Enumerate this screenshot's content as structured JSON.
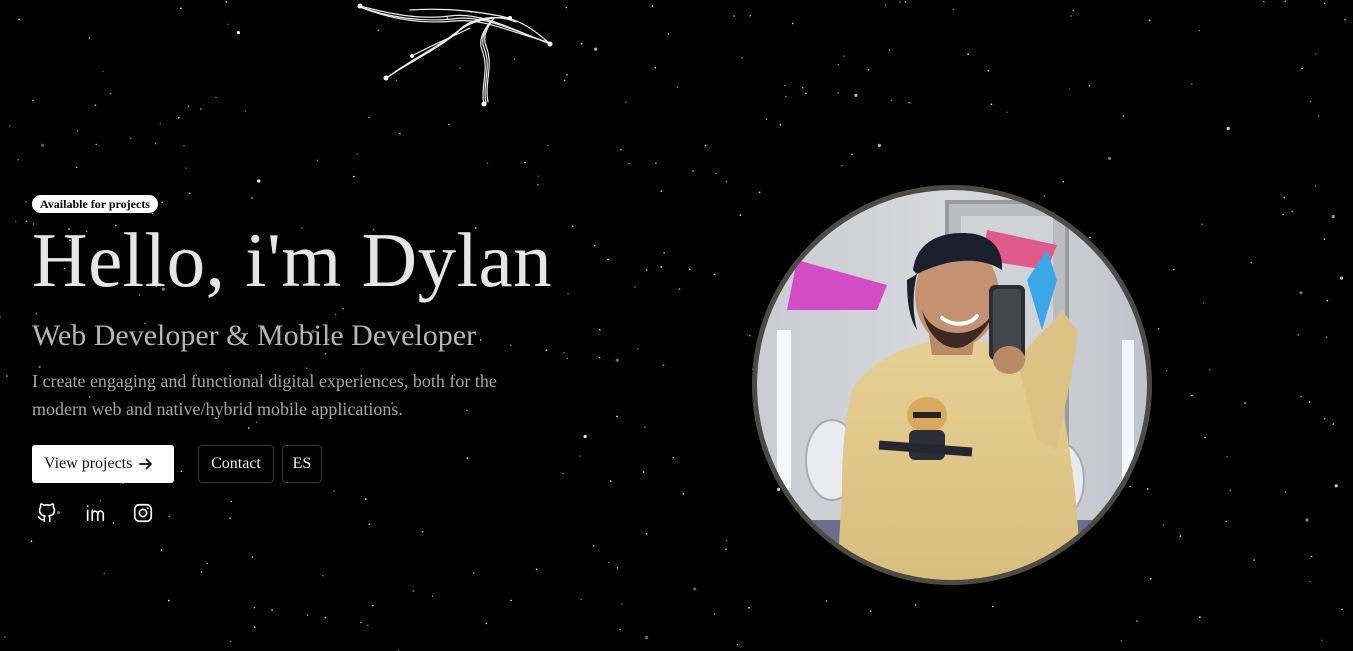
{
  "hero": {
    "badge": "Available for projects",
    "title": "Hello, i'm Dylan",
    "subtitle": "Web Developer & Mobile Developer",
    "description": "I create engaging and functional digital experiences, both for the modern web and native/hybrid mobile applications."
  },
  "actions": {
    "projects_label": "View projects",
    "projects_icon": "arrow-right-icon",
    "contact_label": "Contact",
    "language_label": "ES"
  },
  "socials": [
    {
      "icon": "github-icon"
    },
    {
      "icon": "linkedin-icon"
    },
    {
      "icon": "instagram-icon"
    }
  ],
  "colors": {
    "background": "#000000",
    "text": "#e6e6e6",
    "muted": "#a5a5a5",
    "avatar_border": "#4d4a42"
  }
}
